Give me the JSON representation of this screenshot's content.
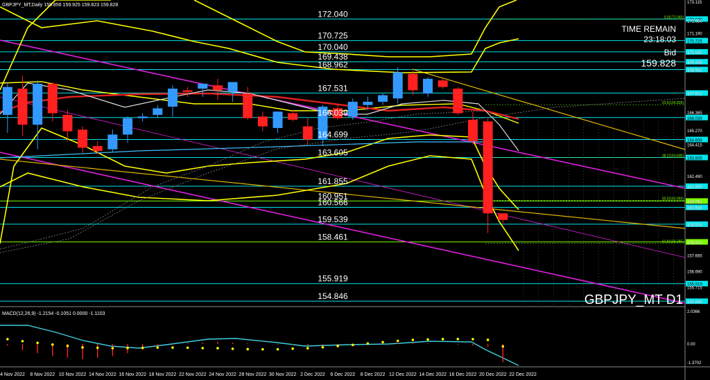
{
  "header": {
    "symbol_line": "GBPJPY_MT,Daily",
    "ohlc_line": "159.856 159.925 159.823 159.828"
  },
  "info": {
    "time_remain_label": "TIME REMAIN",
    "time_remain_value": "23:18:03",
    "bid_label": "Bid",
    "bid_value": "159.828"
  },
  "watermark": "GBPJPY_MT D1",
  "colors": {
    "background": "#000000",
    "bull": "#3399ff",
    "bear": "#ff2020",
    "level_line": "#00e5ee",
    "yellow": "#ffff00",
    "magenta": "#e020e0",
    "orange": "#e6b800",
    "red_ma": "#e02020",
    "white_ma": "#e0e0e0",
    "green_line": "#7cfc00",
    "axis_text": "#ffffff"
  },
  "price_axis_labels": [
    "173.115",
    "171.950",
    "171.190",
    "170.040",
    "169.438",
    "168.962",
    "167.531",
    "166.365",
    "165.270",
    "164.415",
    "162.490",
    "161.855",
    "160.951",
    "160.566",
    "159.539",
    "158.461",
    "157.665",
    "156.690",
    "155.715",
    "154.846"
  ],
  "levels": [
    {
      "text": "172.040",
      "tag": "172.040"
    },
    {
      "text": "170.725",
      "tag": "170.725"
    },
    {
      "text": "170.040",
      "tag": "170.040"
    },
    {
      "text": "169.438",
      "tag": "169.438"
    },
    {
      "text": "168.962",
      "tag": "168.962"
    },
    {
      "text": "167.531",
      "tag": "167.531"
    },
    {
      "text": "166.039",
      "tag": "166.039"
    },
    {
      "text": "164.699",
      "tag": "164.699"
    },
    {
      "text": "163.605",
      "tag": "163.605"
    },
    {
      "text": "161.855",
      "tag": "161.855"
    },
    {
      "text": "160.951",
      "tag": "160.951"
    },
    {
      "text": "160.566",
      "tag": "160.566"
    },
    {
      "text": "159.539",
      "tag": "159.539"
    },
    {
      "text": "158.461",
      "tag": "158.461"
    },
    {
      "text": "155.919",
      "tag": "155.919"
    },
    {
      "text": "154.846",
      "tag": "154.846"
    }
  ],
  "fib_labels": [
    {
      "text": "0.0(172.040)",
      "price": 172.04
    },
    {
      "text": "23.6(166.826)",
      "price": 166.826
    },
    {
      "text": "38.2(163.600)",
      "price": 163.6
    },
    {
      "text": "50.0(160.993)",
      "price": 160.993
    },
    {
      "text": "61.8(158.385)",
      "price": 158.385
    }
  ],
  "macd": {
    "label": "MACD(12,26,9) -1.2154 -0.1051 0.0000 -1.1103",
    "axis_labels": [
      "2.0366",
      "0.00",
      "-1.3702"
    ]
  },
  "date_labels": [
    "4 Nov 2022",
    "8 Nov 2022",
    "10 Nov 2022",
    "14 Nov 2022",
    "16 Nov 2022",
    "18 Nov 2022",
    "22 Nov 2022",
    "24 Nov 2022",
    "28 Nov 2022",
    "30 Nov 2022",
    "2 Dec 2022",
    "6 Dec 2022",
    "8 Dec 2022",
    "12 Dec 2022",
    "14 Dec 2022",
    "16 Dec 2022",
    "20 Dec 2022",
    "22 Dec 2022"
  ],
  "chart_data": {
    "type": "candlestick",
    "symbol": "GBPJPY_MT",
    "timeframe": "Daily",
    "candles": [
      {
        "o": 166.2,
        "h": 168.2,
        "l": 165.1,
        "c": 167.9
      },
      {
        "o": 167.8,
        "h": 168.6,
        "l": 164.9,
        "c": 165.6
      },
      {
        "o": 165.6,
        "h": 168.3,
        "l": 164.1,
        "c": 168.1
      },
      {
        "o": 168.1,
        "h": 168.2,
        "l": 165.8,
        "c": 166.3
      },
      {
        "o": 166.2,
        "h": 166.5,
        "l": 164.6,
        "c": 165.2
      },
      {
        "o": 165.3,
        "h": 165.5,
        "l": 163.9,
        "c": 164.2
      },
      {
        "o": 164.3,
        "h": 164.6,
        "l": 163.8,
        "c": 164.0
      },
      {
        "o": 164.1,
        "h": 165.3,
        "l": 163.9,
        "c": 165.0
      },
      {
        "o": 165.0,
        "h": 166.1,
        "l": 164.5,
        "c": 166.0
      },
      {
        "o": 166.0,
        "h": 166.3,
        "l": 165.8,
        "c": 166.1
      },
      {
        "o": 166.2,
        "h": 166.8,
        "l": 166.0,
        "c": 166.6
      },
      {
        "o": 166.7,
        "h": 168.0,
        "l": 166.1,
        "c": 167.8
      },
      {
        "o": 167.7,
        "h": 167.9,
        "l": 167.3,
        "c": 167.6
      },
      {
        "o": 167.8,
        "h": 168.1,
        "l": 167.3,
        "c": 168.1
      },
      {
        "o": 168.0,
        "h": 168.4,
        "l": 167.1,
        "c": 167.7
      },
      {
        "o": 167.6,
        "h": 168.2,
        "l": 167.0,
        "c": 168.2
      },
      {
        "o": 167.5,
        "h": 167.9,
        "l": 165.9,
        "c": 166.0
      },
      {
        "o": 166.1,
        "h": 166.4,
        "l": 165.2,
        "c": 165.5
      },
      {
        "o": 165.4,
        "h": 166.4,
        "l": 165.1,
        "c": 166.4
      },
      {
        "o": 166.3,
        "h": 166.5,
        "l": 165.8,
        "c": 165.9
      },
      {
        "o": 165.5,
        "h": 166.0,
        "l": 164.4,
        "c": 164.7
      },
      {
        "o": 164.7,
        "h": 166.8,
        "l": 164.3,
        "c": 166.7
      },
      {
        "o": 166.6,
        "h": 166.8,
        "l": 165.9,
        "c": 166.0
      },
      {
        "o": 166.1,
        "h": 167.2,
        "l": 165.9,
        "c": 167.0
      },
      {
        "o": 166.8,
        "h": 167.3,
        "l": 166.5,
        "c": 167.0
      },
      {
        "o": 167.0,
        "h": 167.5,
        "l": 166.8,
        "c": 167.4
      },
      {
        "o": 167.2,
        "h": 169.1,
        "l": 166.9,
        "c": 168.8
      },
      {
        "o": 168.7,
        "h": 168.9,
        "l": 167.4,
        "c": 167.7
      },
      {
        "o": 167.5,
        "h": 168.5,
        "l": 167.3,
        "c": 168.4
      },
      {
        "o": 168.3,
        "h": 168.4,
        "l": 167.8,
        "c": 167.9
      },
      {
        "o": 167.8,
        "h": 167.9,
        "l": 166.2,
        "c": 166.3
      },
      {
        "o": 165.9,
        "h": 166.4,
        "l": 164.4,
        "c": 164.6
      },
      {
        "o": 165.8,
        "h": 166.0,
        "l": 159.0,
        "c": 160.2
      },
      {
        "o": 160.2,
        "h": 160.2,
        "l": 159.6,
        "c": 159.8
      }
    ],
    "macd_histogram": [
      -0.1,
      -0.4,
      -0.6,
      -0.8,
      -0.9,
      -1.0,
      -0.9,
      -0.8,
      -0.6,
      -0.4,
      -0.2,
      -0.05,
      0.05,
      0.1,
      0.15,
      0.1,
      0.05,
      0.0,
      -0.05,
      -0.05,
      -0.1,
      -0.1,
      -0.05,
      -0.05,
      0.0,
      0.05,
      0.1,
      0.1,
      0.05,
      0.0,
      -0.05,
      -0.1,
      -0.2,
      -1.2
    ]
  }
}
